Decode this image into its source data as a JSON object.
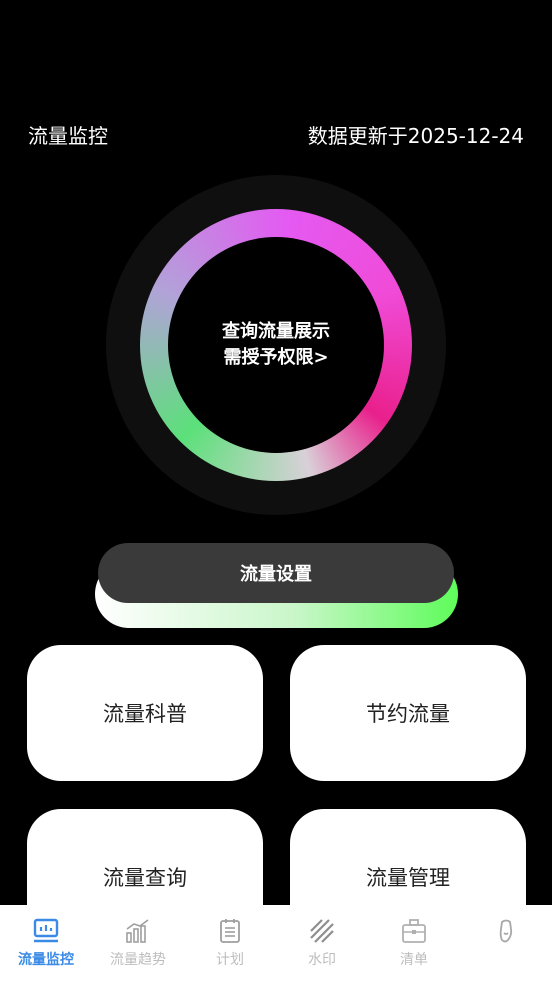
{
  "header": {
    "title": "流量监控",
    "updated": "数据更新于2025-12-24"
  },
  "ring": {
    "line1": "查询流量展示",
    "line2": "需授予权限>"
  },
  "primary_button": {
    "label": "流量设置"
  },
  "cards": [
    {
      "label": "流量科普"
    },
    {
      "label": "节约流量"
    },
    {
      "label": "流量查询"
    },
    {
      "label": "流量管理"
    }
  ],
  "tabs": [
    {
      "label": "流量监控",
      "icon": "monitor-icon",
      "active": true
    },
    {
      "label": "流量趋势",
      "icon": "chart-icon",
      "active": false
    },
    {
      "label": "计划",
      "icon": "clipboard-icon",
      "active": false
    },
    {
      "label": "水印",
      "icon": "watermark-icon",
      "active": false
    },
    {
      "label": "清单",
      "icon": "briefcase-icon",
      "active": false
    },
    {
      "label": "",
      "icon": "profile-icon",
      "active": false
    }
  ],
  "colors": {
    "active_tab": "#3a8ae6",
    "inactive_tab": "#bdbdbd",
    "button_dark": "#3a3a3a",
    "accent_green": "#5efc5a",
    "accent_pink": "#e9208c"
  }
}
